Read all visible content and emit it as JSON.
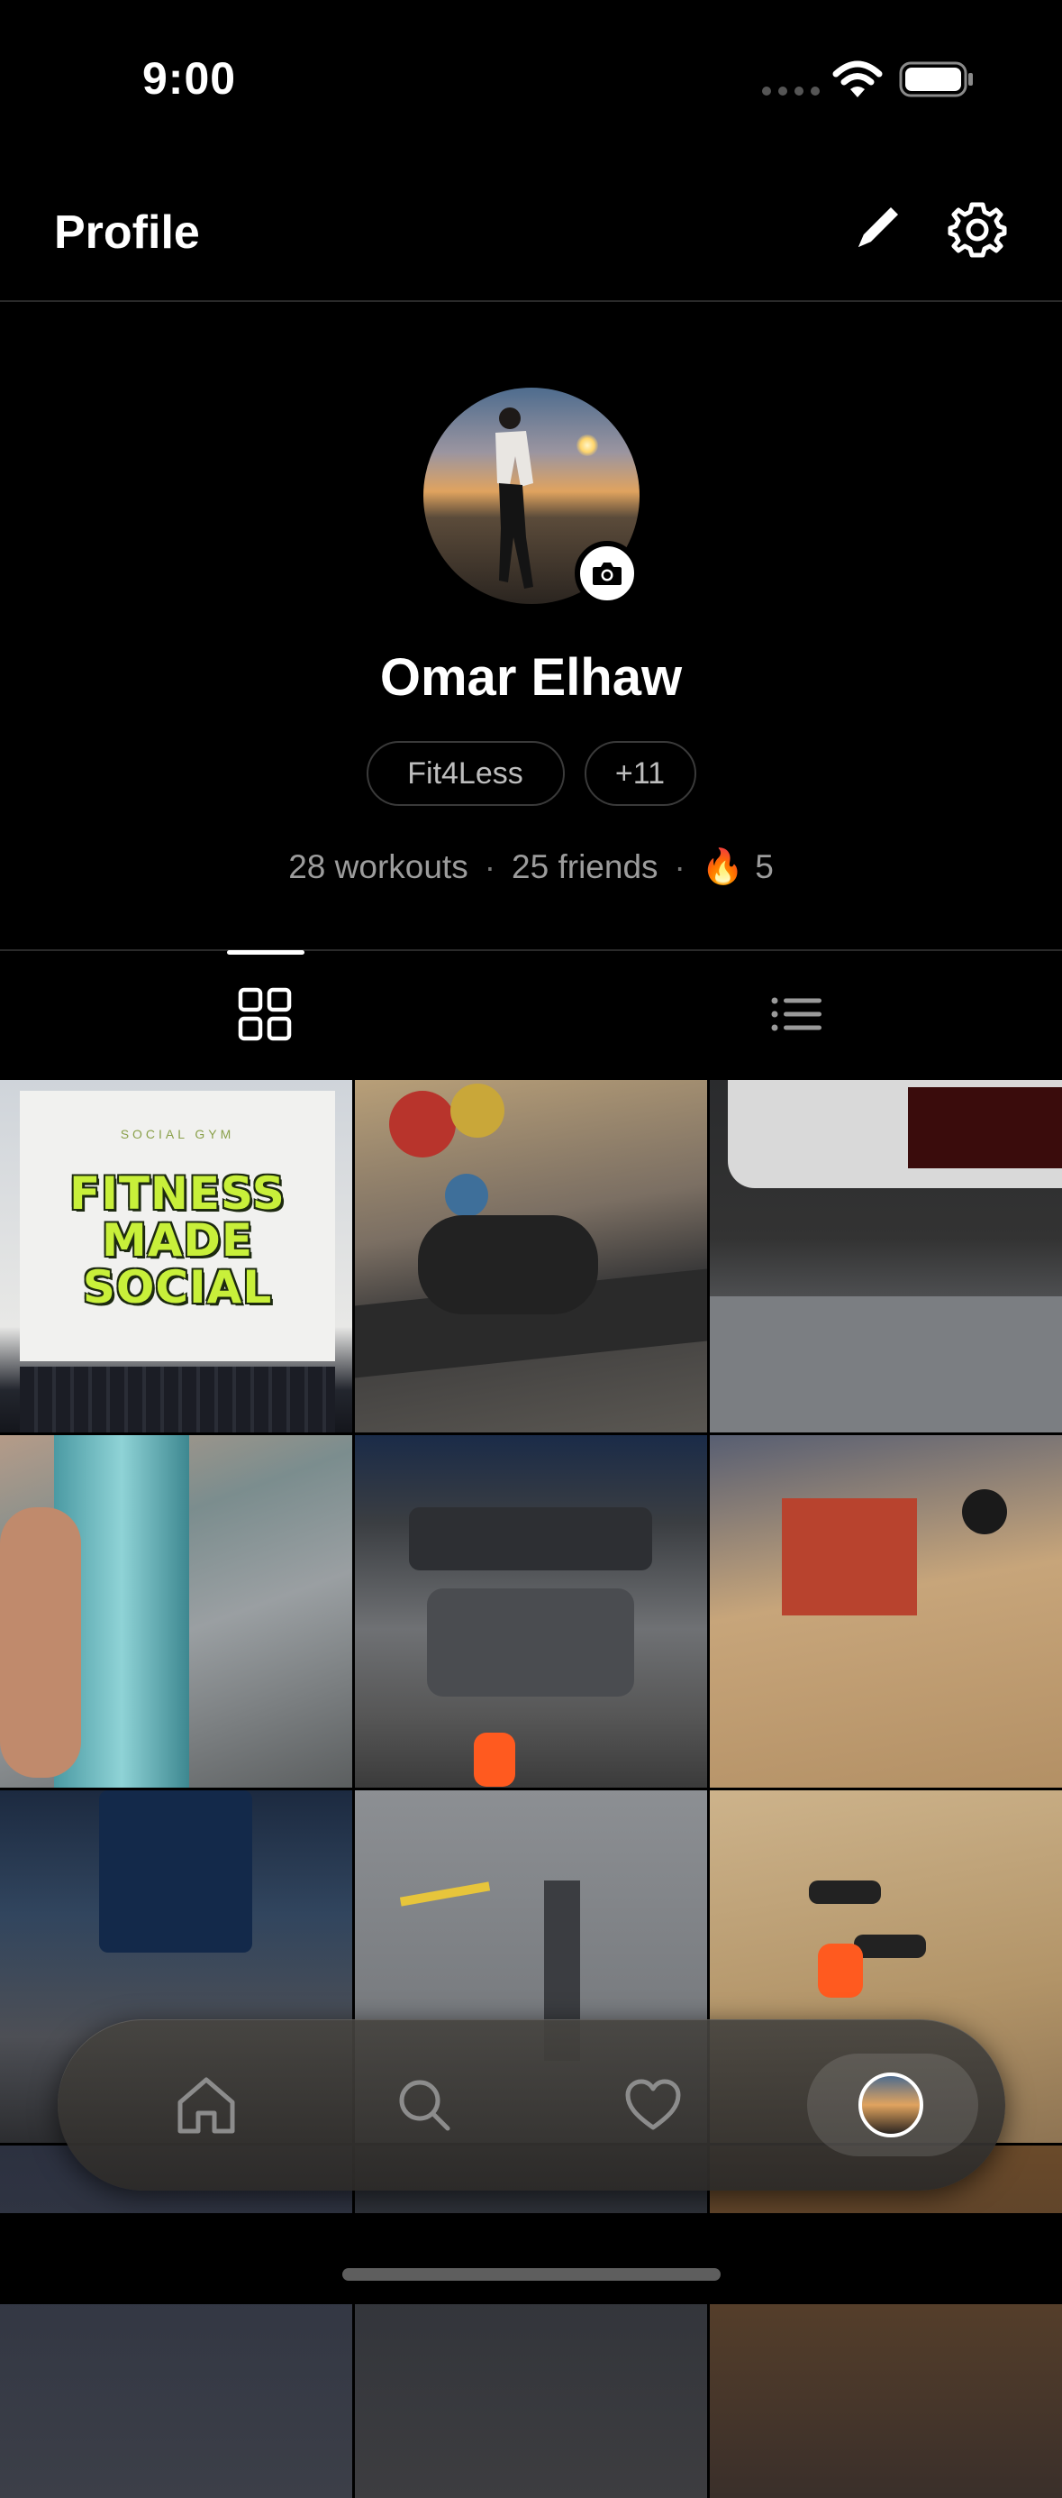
{
  "status_bar": {
    "time": "9:00",
    "icons": [
      "signal-dots-icon",
      "wifi-icon",
      "battery-icon"
    ]
  },
  "header": {
    "title": "Profile",
    "actions": [
      "pencil-icon",
      "gear-icon"
    ]
  },
  "profile": {
    "name": "Omar Elhaw",
    "avatar_badge_icon": "camera-icon",
    "chips": [
      "Fit4Less",
      "+11"
    ],
    "stats": {
      "workouts": "28 workouts",
      "separator": "·",
      "friends": "25 friends",
      "streak_icon": "🔥",
      "streak": "5"
    }
  },
  "tabs": {
    "items": [
      "grid-view-icon",
      "list-view-icon"
    ],
    "active": "grid-view-icon"
  },
  "grid": {
    "poster_top": "SOCIAL GYM",
    "poster_lines": [
      "FITNESS",
      "MADE",
      "SOCIAL"
    ],
    "tile_count": 12
  },
  "bottom_nav": {
    "items": [
      "home-icon",
      "search-icon",
      "heart-icon",
      "profile-avatar"
    ],
    "active": "profile-avatar"
  },
  "colors": {
    "background": "#000000",
    "text_primary": "#ffffff",
    "text_secondary": "#9c9c9c",
    "chip_border": "#3a3a3a",
    "poster_green": "#c8f03a"
  }
}
